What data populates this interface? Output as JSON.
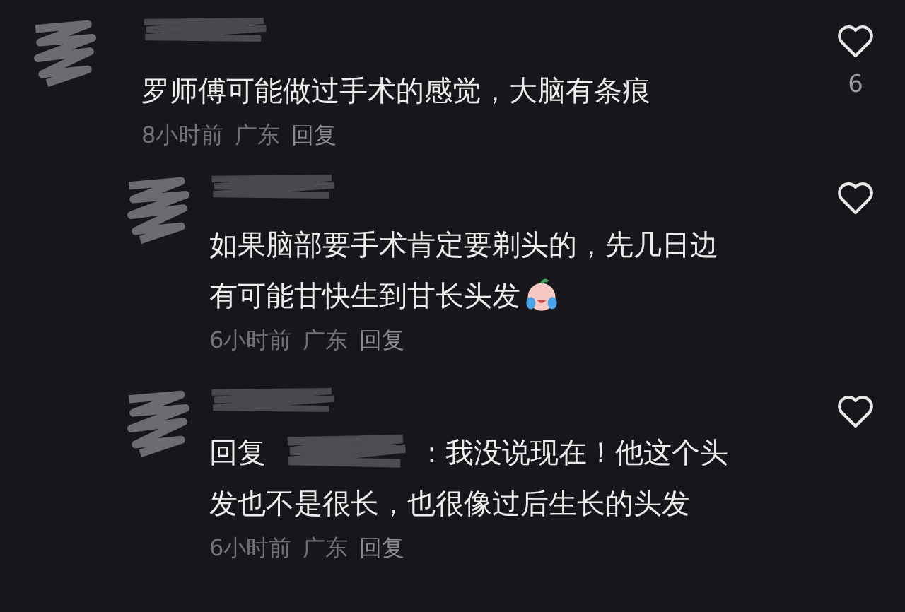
{
  "comments": [
    {
      "lines": [
        "罗师傅可能做过手术的感觉，大脑有条痕"
      ],
      "time": "8小时前",
      "region": "广东",
      "reply_action": "回复",
      "likes": "6",
      "replies": [
        {
          "lines": [
            "如果脑部要手术肯定要剃头的，先几日边",
            "有可能甘快生到甘长头发"
          ],
          "time": "6小时前",
          "region": "广东",
          "reply_action": "回复",
          "emoji": true
        },
        {
          "reply_prefix": "回复",
          "lines": [
            ": 我没说现在！他这个头",
            "发也不是很长，也很像过后生长的头发"
          ],
          "time": "6小时前",
          "region": "广东",
          "reply_action": "回复"
        }
      ]
    }
  ]
}
